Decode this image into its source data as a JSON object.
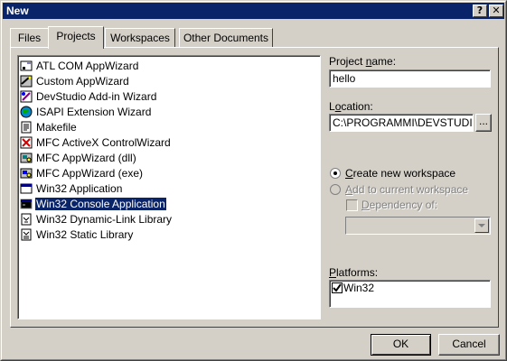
{
  "window": {
    "title": "New",
    "help_glyph": "?",
    "close_glyph": "✕"
  },
  "tabs": [
    {
      "label": "Files",
      "active": false
    },
    {
      "label": "Projects",
      "active": true
    },
    {
      "label": "Workspaces",
      "active": false
    },
    {
      "label": "Other Documents",
      "active": false
    }
  ],
  "project_types": [
    {
      "label": "ATL COM AppWizard",
      "icon": "atl-com-icon",
      "selected": false
    },
    {
      "label": "Custom AppWizard",
      "icon": "custom-wizard-icon",
      "selected": false
    },
    {
      "label": "DevStudio Add-in Wizard",
      "icon": "addin-wizard-icon",
      "selected": false
    },
    {
      "label": "ISAPI Extension Wizard",
      "icon": "isapi-globe-icon",
      "selected": false
    },
    {
      "label": "Makefile",
      "icon": "makefile-icon",
      "selected": false
    },
    {
      "label": "MFC ActiveX ControlWizard",
      "icon": "activex-icon",
      "selected": false
    },
    {
      "label": "MFC AppWizard (dll)",
      "icon": "mfc-dll-icon",
      "selected": false
    },
    {
      "label": "MFC AppWizard (exe)",
      "icon": "mfc-exe-icon",
      "selected": false
    },
    {
      "label": "Win32 Application",
      "icon": "win32-app-icon",
      "selected": false
    },
    {
      "label": "Win32 Console Application",
      "icon": "console-app-icon",
      "selected": true
    },
    {
      "label": "Win32 Dynamic-Link Library",
      "icon": "dll-icon",
      "selected": false
    },
    {
      "label": "Win32 Static Library",
      "icon": "static-lib-icon",
      "selected": false
    }
  ],
  "project_name": {
    "label_pre": "Project ",
    "label_key": "n",
    "label_post": "ame:",
    "value": "hello"
  },
  "location": {
    "label_pre": "L",
    "label_key": "o",
    "label_post": "cation:",
    "value": "C:\\PROGRAMMI\\DEVSTUDIO\\",
    "browse_label": "..."
  },
  "workspace_options": {
    "create_new": {
      "pre": "",
      "key": "C",
      "post": "reate new workspace",
      "checked": true
    },
    "add_current": {
      "pre": "",
      "key": "A",
      "post": "dd to current workspace",
      "checked": false,
      "disabled": true
    },
    "dependency": {
      "pre": "",
      "key": "D",
      "post": "ependency of:",
      "checked": false,
      "disabled": true
    },
    "dependency_value": ""
  },
  "platforms": {
    "label_pre": "",
    "label_key": "P",
    "label_post": "latforms:",
    "items": [
      {
        "label": "Win32",
        "checked": true
      }
    ]
  },
  "buttons": {
    "ok": "OK",
    "cancel": "Cancel"
  },
  "colors": {
    "title_bar": "#0a246a",
    "face": "#d4d0c8",
    "selection": "#0a246a"
  }
}
